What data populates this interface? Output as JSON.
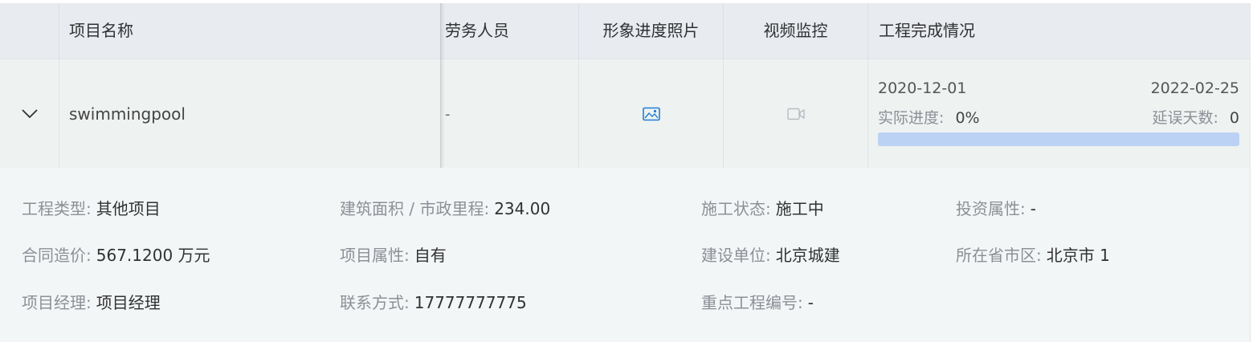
{
  "table": {
    "columns": {
      "name": "项目名称",
      "labor": "劳务人员",
      "photos": "形象进度照片",
      "video": "视频监控",
      "completion": "工程完成情况"
    },
    "row": {
      "expand_icon": "chevron-down-icon",
      "name": "swimmingpool",
      "labor": "-",
      "photo_icon": "image-icon",
      "video_icon": "video-camera-icon",
      "start_date": "2020-12-01",
      "end_date": "2022-02-25",
      "actual_progress_label": "实际进度:",
      "actual_progress_value": "0%",
      "delay_days_label": "延误天数:",
      "delay_days_value": "0",
      "progress_fraction": 0
    }
  },
  "details": {
    "project_type_label": "工程类型:",
    "project_type_value": "其他项目",
    "area_label": "建筑面积 / 市政里程:",
    "area_value": "234.00",
    "status_label": "施工状态:",
    "status_value": "施工中",
    "investment_label": "投资属性:",
    "investment_value": "-",
    "contract_label": "合同造价:",
    "contract_value": "567.1200 万元",
    "property_label": "项目属性:",
    "property_value": "自有",
    "builder_label": "建设单位:",
    "builder_value": "北京城建",
    "region_label": "所在省市区:",
    "region_value": "北京市 1",
    "manager_label": "项目经理:",
    "manager_value": "项目经理",
    "contact_label": "联系方式:",
    "contact_value": "17777777775",
    "key_project_label": "重点工程编号:",
    "key_project_value": "-"
  },
  "colors": {
    "header_bg": "#e8ebef",
    "row_bg": "#eef2f1",
    "detail_bg": "#f3f6f7",
    "progress_bar": "#bcd2f4",
    "accent": "#1e7fd6"
  }
}
